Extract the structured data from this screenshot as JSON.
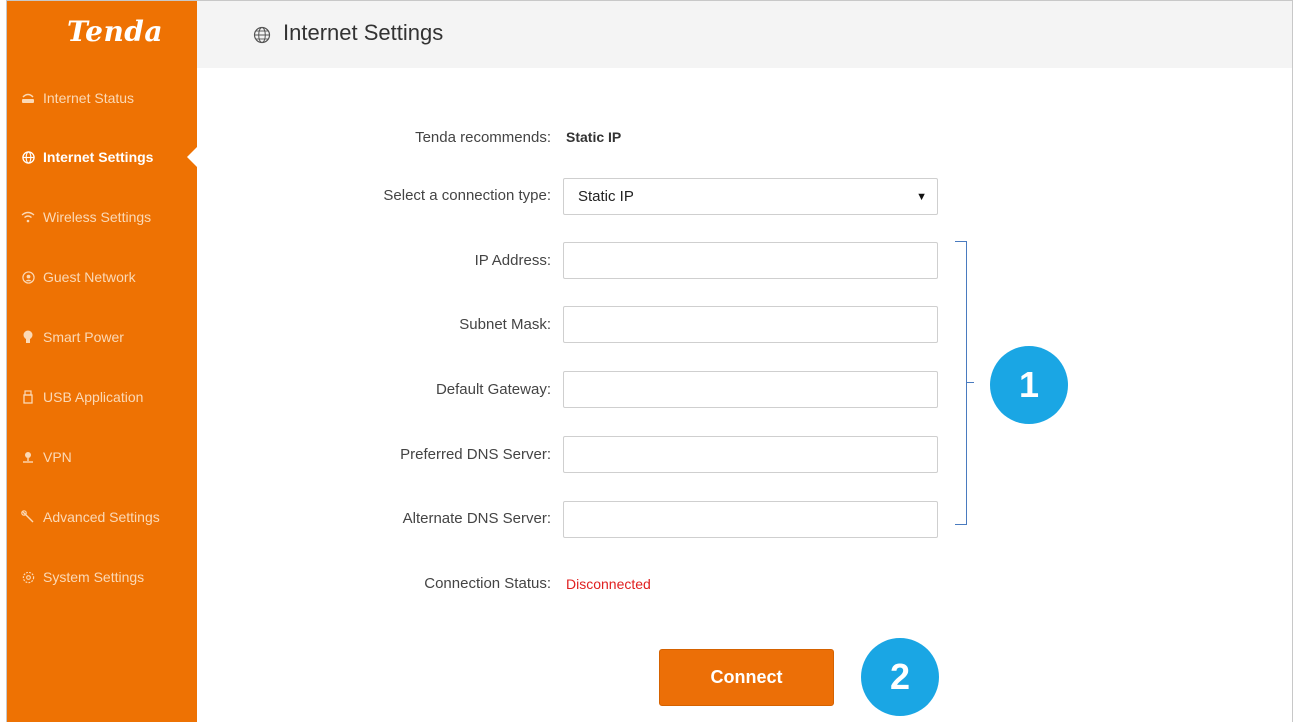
{
  "brand": {
    "logo": "Tenda"
  },
  "sidebar": {
    "items": [
      {
        "label": "Internet Status",
        "icon": "router-icon",
        "active": false
      },
      {
        "label": "Internet Settings",
        "icon": "globe-icon",
        "active": true
      },
      {
        "label": "Wireless Settings",
        "icon": "wifi-icon",
        "active": false
      },
      {
        "label": "Guest Network",
        "icon": "guest-icon",
        "active": false
      },
      {
        "label": "Smart Power",
        "icon": "bulb-icon",
        "active": false
      },
      {
        "label": "USB Application",
        "icon": "usb-icon",
        "active": false
      },
      {
        "label": "VPN",
        "icon": "vpn-icon",
        "active": false
      },
      {
        "label": "Advanced Settings",
        "icon": "wrench-icon",
        "active": false
      },
      {
        "label": "System Settings",
        "icon": "gear-icon",
        "active": false
      }
    ]
  },
  "header": {
    "title": "Internet Settings"
  },
  "form": {
    "recommend_label": "Tenda recommends:",
    "recommend_value": "Static IP",
    "conn_type_label": "Select a connection type:",
    "conn_type_value": "Static IP",
    "ip_label": "IP Address:",
    "subnet_label": "Subnet Mask:",
    "gateway_label": "Default Gateway:",
    "dns1_label": "Preferred DNS Server:",
    "dns2_label": "Alternate DNS Server:",
    "status_label": "Connection Status:",
    "status_value": "Disconnected",
    "connect_label": "Connect"
  },
  "callouts": {
    "one": "1",
    "two": "2"
  },
  "colors": {
    "sidebar": "#ee7203",
    "button": "#ec6f07",
    "badge": "#1aa6e4",
    "status": "#e02020"
  }
}
